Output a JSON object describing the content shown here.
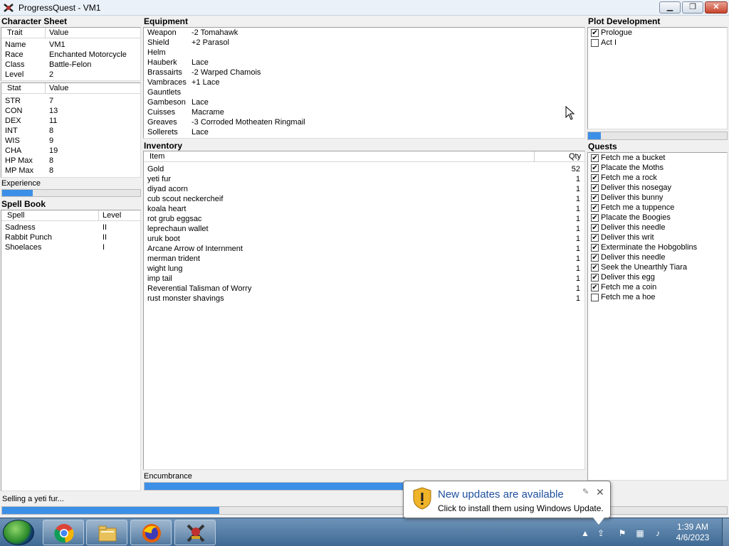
{
  "window": {
    "title": "ProgressQuest - VM1"
  },
  "character_sheet": {
    "header": "Character Sheet",
    "trait_col": "Trait",
    "value_col": "Value",
    "traits": [
      {
        "name": "Name",
        "value": "VM1"
      },
      {
        "name": "Race",
        "value": "Enchanted Motorcycle"
      },
      {
        "name": "Class",
        "value": "Battle-Felon"
      },
      {
        "name": "Level",
        "value": "2"
      }
    ],
    "stat_col": "Stat",
    "stat_value_col": "Value",
    "stats": [
      {
        "name": "STR",
        "value": "7"
      },
      {
        "name": "CON",
        "value": "13"
      },
      {
        "name": "DEX",
        "value": "11"
      },
      {
        "name": "INT",
        "value": "8"
      },
      {
        "name": "WIS",
        "value": "9"
      },
      {
        "name": "CHA",
        "value": "19"
      },
      {
        "name": "HP Max",
        "value": "8"
      },
      {
        "name": "MP Max",
        "value": "8"
      }
    ],
    "experience_label": "Experience",
    "experience_progress": 0.22
  },
  "spell_book": {
    "header": "Spell Book",
    "spell_col": "Spell",
    "level_col": "Level",
    "spells": [
      {
        "name": "Sadness",
        "level": "II"
      },
      {
        "name": "Rabbit Punch",
        "level": "II"
      },
      {
        "name": "Shoelaces",
        "level": "I"
      }
    ]
  },
  "equipment": {
    "header": "Equipment",
    "items": [
      {
        "slot": "Weapon",
        "item": "-2 Tomahawk"
      },
      {
        "slot": "Shield",
        "item": "+2 Parasol"
      },
      {
        "slot": "Helm",
        "item": ""
      },
      {
        "slot": "Hauberk",
        "item": "Lace"
      },
      {
        "slot": "Brassairts",
        "item": "-2 Warped Chamois"
      },
      {
        "slot": "Vambraces",
        "item": "+1 Lace"
      },
      {
        "slot": "Gauntlets",
        "item": ""
      },
      {
        "slot": "Gambeson",
        "item": "Lace"
      },
      {
        "slot": "Cuisses",
        "item": "Macrame"
      },
      {
        "slot": "Greaves",
        "item": "-3 Corroded Motheaten Ringmail"
      },
      {
        "slot": "Sollerets",
        "item": "Lace"
      }
    ]
  },
  "inventory": {
    "header": "Inventory",
    "item_col": "Item",
    "qty_col": "Qty",
    "items": [
      {
        "name": "Gold",
        "qty": "52"
      },
      {
        "name": "yeti fur",
        "qty": "1"
      },
      {
        "name": "diyad acorn",
        "qty": "1"
      },
      {
        "name": "cub scout neckercheif",
        "qty": "1"
      },
      {
        "name": "koala heart",
        "qty": "1"
      },
      {
        "name": "rot grub eggsac",
        "qty": "1"
      },
      {
        "name": "leprechaun wallet",
        "qty": "1"
      },
      {
        "name": "uruk boot",
        "qty": "1"
      },
      {
        "name": "Arcane Arrow of Internment",
        "qty": "1"
      },
      {
        "name": "merman trident",
        "qty": "1"
      },
      {
        "name": "wight lung",
        "qty": "1"
      },
      {
        "name": "imp tail",
        "qty": "1"
      },
      {
        "name": "Reverential Talisman of Worry",
        "qty": "1"
      },
      {
        "name": "rust monster shavings",
        "qty": "1"
      }
    ],
    "encumbrance_label": "Encumbrance",
    "encumbrance_progress": 0.91
  },
  "plot": {
    "header": "Plot Development",
    "acts": [
      {
        "label": "Prologue",
        "done": true
      },
      {
        "label": "Act I",
        "done": false
      }
    ],
    "progress": 0.09
  },
  "quests": {
    "header": "Quests",
    "items": [
      {
        "label": "Fetch me a bucket",
        "done": true
      },
      {
        "label": "Placate the Moths",
        "done": true
      },
      {
        "label": "Fetch me a rock",
        "done": true
      },
      {
        "label": "Deliver this nosegay",
        "done": true
      },
      {
        "label": "Deliver this bunny",
        "done": true
      },
      {
        "label": "Fetch me a tuppence",
        "done": true
      },
      {
        "label": "Placate the Boogies",
        "done": true
      },
      {
        "label": "Deliver this needle",
        "done": true
      },
      {
        "label": "Deliver this writ",
        "done": true
      },
      {
        "label": "Exterminate the Hobgoblins",
        "done": true
      },
      {
        "label": "Deliver this needle",
        "done": true
      },
      {
        "label": "Seek the Unearthly Tiara",
        "done": true
      },
      {
        "label": "Deliver this egg",
        "done": true
      },
      {
        "label": "Fetch me a coin",
        "done": true
      },
      {
        "label": "Fetch me a hoe",
        "done": false
      }
    ]
  },
  "status": {
    "text": "Selling a yeti fur...",
    "progress": 0.3
  },
  "notification": {
    "title": "New updates are available",
    "body": "Click to install them using Windows Update."
  },
  "taskbar": {
    "time": "1:39 AM",
    "date": "4/6/2023",
    "buttons": [
      "chrome-icon",
      "file-explorer-icon",
      "firefox-icon",
      "progressquest-icon"
    ]
  },
  "colors": {
    "progress": "#3c8fe6",
    "title_blue": "#1e4f9c"
  }
}
